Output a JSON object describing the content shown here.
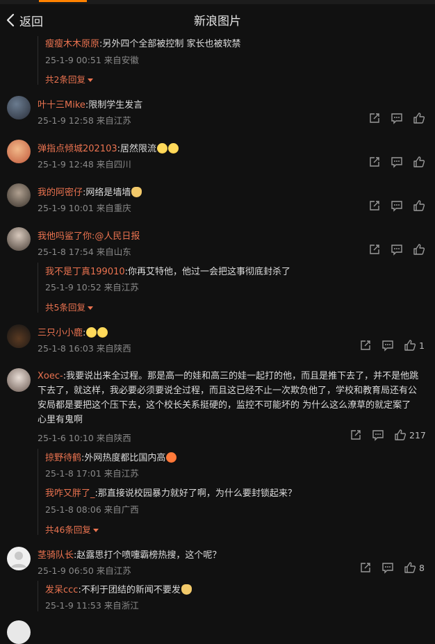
{
  "header": {
    "back_label": "返回",
    "title": "新浪图片"
  },
  "thread0": {
    "reply": {
      "name": "瘦瘦木木原原",
      "text": ":另外四个全部被控制 家长也被软禁",
      "meta": "25-1-9 00:51 来自安徽"
    },
    "more": "共2条回复"
  },
  "c1": {
    "name": "叶十三Mike",
    "text": ":限制学生发言",
    "meta": "25-1-9 12:58 来自江苏"
  },
  "c2": {
    "name": "弹指点倾城202103",
    "text": ":居然限流",
    "meta": "25-1-9 12:48 来自四川"
  },
  "c3": {
    "name": "我的阿密仔",
    "text": ":网络是墙墙",
    "meta": "25-1-9 10:01 来自重庆"
  },
  "c4": {
    "name": "我他吗鲨了你",
    "text": ":@人民日报",
    "meta": "25-1-8 17:54 来自山东",
    "reply": {
      "name": "我不是丁真199010",
      "text": ":你再艾特他，他过一会把这事彻底封杀了",
      "meta": "25-1-9 10:52 来自江苏"
    },
    "more": "共5条回复"
  },
  "c5": {
    "name": "三只小小鹿",
    "text": ":",
    "meta": "25-1-8 16:03 来自陕西",
    "likes": "1"
  },
  "c6": {
    "name": "Xoec-",
    "line1": ":我要说出来全过程。那是高一的娃和高三的娃一起打的他，而且是推下去了，并不是他跳",
    "line2": "下去了，就这样，我必要必须要说全过程，而且这已经不止一次欺负他了，学校和教育局还有公",
    "line3": "安局都是要把这个压下去，这个校长关系挺硬的，监控不可能坏的 为什么这么潦草的就定案了",
    "line4": "心里有鬼啊",
    "meta": "25-1-6 10:10 来自陕西",
    "likes": "217",
    "reply1": {
      "name": "掠野待鹤",
      "text": ":外网热度都比国内高",
      "meta": "25-1-8 17:01 来自江苏"
    },
    "reply2": {
      "name": "我咋又胖了_",
      "text": ":那直接说校园暴力就好了啊，为什么要封锁起来？",
      "meta": "25-1-8 08:06 来自广西"
    },
    "more": "共46条回复"
  },
  "c7": {
    "name": "茎骑队长",
    "text": ":赵露思打个喷嚏霸榜热搜，这个呢？",
    "meta": "25-1-9 06:50 来自江苏",
    "likes": "8",
    "reply": {
      "name": "发呆ccc",
      "text": ":不利于团结的新闻不要发",
      "meta": "25-1-9 11:53 来自浙江"
    }
  },
  "colors": {
    "accent": "#ff8200",
    "username": "#eb7350",
    "background": "#111111",
    "meta": "#8a8a8a"
  },
  "icons": [
    "chevron-left-icon",
    "share-icon",
    "comment-icon",
    "like-icon",
    "emoji-icon"
  ]
}
